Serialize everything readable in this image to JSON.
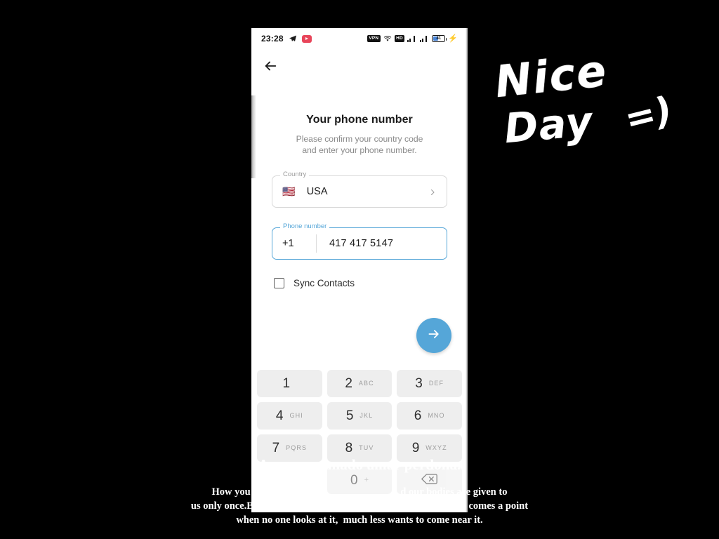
{
  "statusbar": {
    "time": "23:28",
    "left_icons": [
      "telegram-icon",
      "youtube-icon"
    ],
    "vpn_label": "VPN",
    "hd_label": "HD",
    "battery_percent": "41",
    "icons": [
      "vpn-badge",
      "wifi-icon",
      "hd-badge",
      "signal-sim1-icon",
      "signal-sim2-icon",
      "battery-icon",
      "charging-bolt-icon"
    ]
  },
  "appbar": {
    "back_icon": "arrow-left-icon"
  },
  "screen": {
    "title": "Your phone number",
    "subtitle_line1": "Please confirm your country code",
    "subtitle_line2": "and enter your phone number."
  },
  "country_field": {
    "label": "Country",
    "flag": "🇺🇸",
    "value": "USA",
    "chevron_icon": "chevron-right-icon"
  },
  "phone_field": {
    "label": "Phone number",
    "dial_code": "+1",
    "value": "417 417 5147",
    "focused": true,
    "focus_color": "#55a6d8"
  },
  "sync": {
    "label": "Sync Contacts",
    "checked": false
  },
  "fab": {
    "icon": "arrow-right-icon",
    "color": "#55a6d8"
  },
  "keypad": {
    "keys": [
      {
        "num": "1",
        "sub": ""
      },
      {
        "num": "2",
        "sub": "ABC"
      },
      {
        "num": "3",
        "sub": "DEF"
      },
      {
        "num": "4",
        "sub": "GHI"
      },
      {
        "num": "5",
        "sub": "JKL"
      },
      {
        "num": "6",
        "sub": "MNO"
      },
      {
        "num": "7",
        "sub": "PQRS"
      },
      {
        "num": "8",
        "sub": "TUV"
      },
      {
        "num": "9",
        "sub": "WXYZ"
      },
      {
        "num": "0",
        "sub": "+"
      }
    ],
    "backspace_icon": "backspace-icon"
  },
  "handwriting": {
    "word1": "Nice",
    "word2": "Day",
    "emoticon": "=)"
  },
  "captions": {
    "headline": "Amor c            o  amado amar perdona.",
    "line1": "How you live your life is y                              d our bodies are given to",
    "line2": "us only once.Before you know it,  h                 as your body there comes a point",
    "line3": "when no one looks at it,  much less wants to come near it."
  }
}
